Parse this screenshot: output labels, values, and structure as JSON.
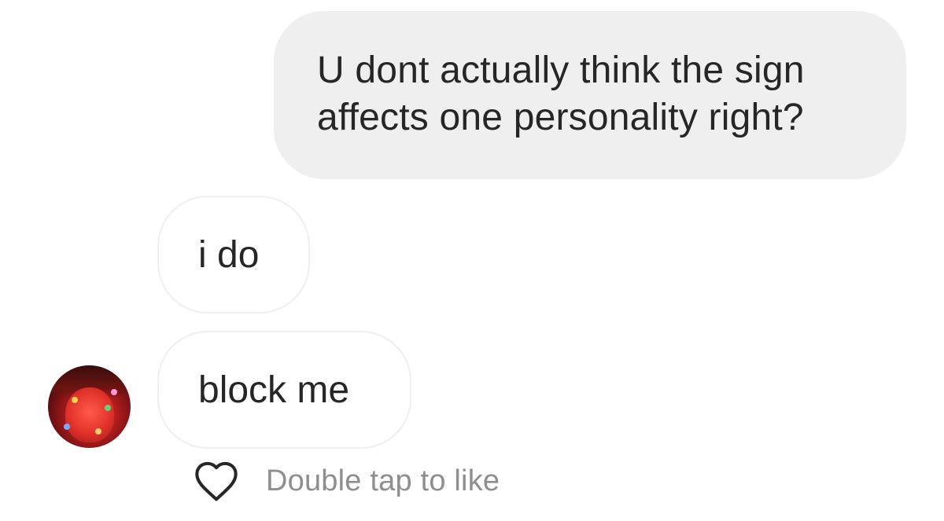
{
  "messages": {
    "outgoing": {
      "line1": "U dont actually think the sign",
      "line2": "affects one personality right?"
    },
    "incoming": [
      {
        "text": "i do"
      },
      {
        "text": "block me"
      }
    ]
  },
  "like_action": {
    "label": "Double tap to like",
    "icon": "heart-outline-icon"
  },
  "colors": {
    "outgoing_bubble_bg": "#efefef",
    "incoming_bubble_border": "#efefef",
    "text": "#262626",
    "secondary_text": "#8e8e8e"
  }
}
